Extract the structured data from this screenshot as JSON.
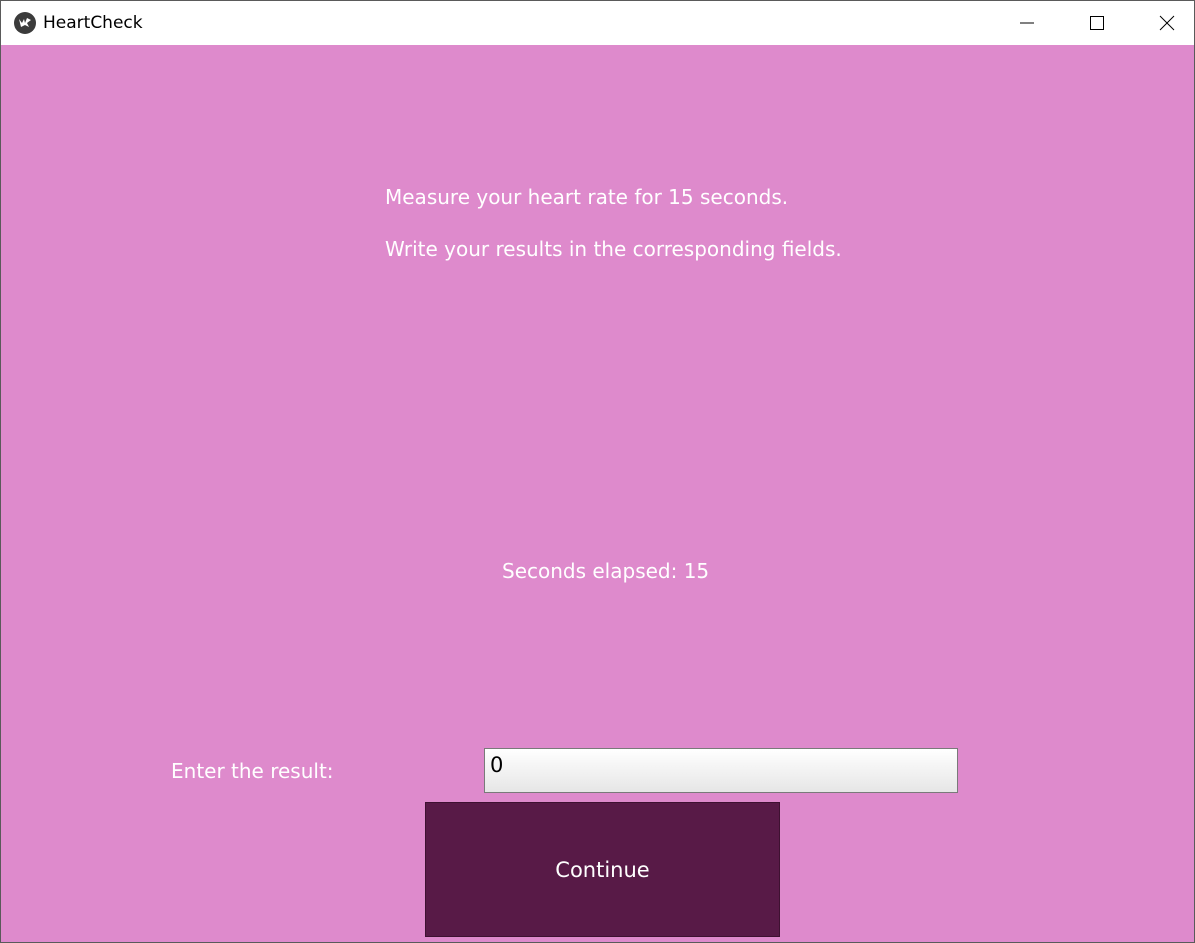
{
  "window": {
    "title": "HeartCheck",
    "controls": {
      "minimize": "minimize-icon",
      "maximize": "maximize-icon",
      "close": "close-icon"
    }
  },
  "colors": {
    "background": "#de8acc",
    "button": "#581a47",
    "text": "#ffffff"
  },
  "instructions": {
    "line1": "Measure your heart rate for 15 seconds.",
    "line2": "Write your results in the corresponding fields."
  },
  "timer": {
    "text": "Seconds elapsed: 15"
  },
  "result": {
    "label": "Enter the result:",
    "value": "0"
  },
  "continue_button": {
    "label": "Continue"
  }
}
